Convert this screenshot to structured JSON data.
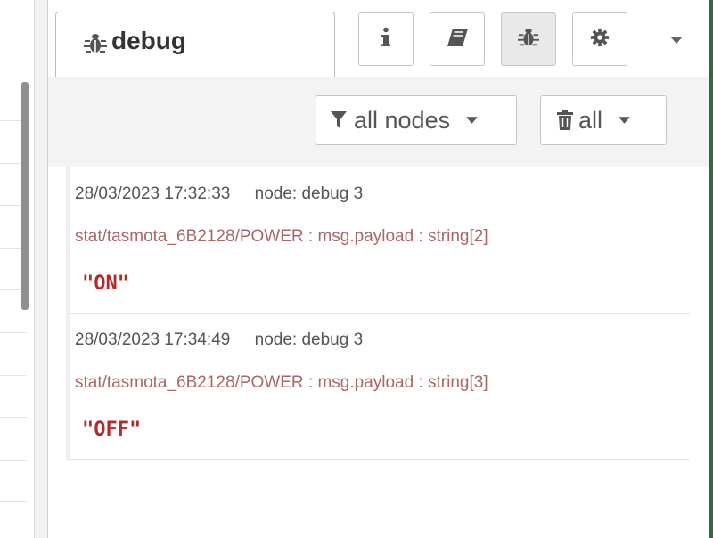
{
  "sidebar": {
    "active_tab": {
      "label": "debug",
      "icon": "bug-icon"
    },
    "tab_buttons": [
      {
        "name": "info",
        "icon": "info-icon",
        "active": false
      },
      {
        "name": "help",
        "icon": "book-icon",
        "active": false
      },
      {
        "name": "debug",
        "icon": "bug-icon",
        "active": true
      },
      {
        "name": "config",
        "icon": "gear-icon",
        "active": false
      }
    ],
    "menu_icon": "chevron-down-icon"
  },
  "filter": {
    "nodes_label": "all nodes",
    "clear_label": "all"
  },
  "messages": [
    {
      "timestamp": "28/03/2023 17:32:33",
      "node": "node: debug 3",
      "topic": "stat/tasmota_6B2128/POWER : msg.payload : string[2]",
      "value": "\"ON\""
    },
    {
      "timestamp": "28/03/2023 17:34:49",
      "node": "node: debug 3",
      "topic": "stat/tasmota_6B2128/POWER : msg.payload : string[3]",
      "value": "\"OFF\""
    }
  ],
  "colors": {
    "topic": "#aa6666",
    "payload_string": "#b72828",
    "toolbar_bg": "#f3f3f3"
  }
}
